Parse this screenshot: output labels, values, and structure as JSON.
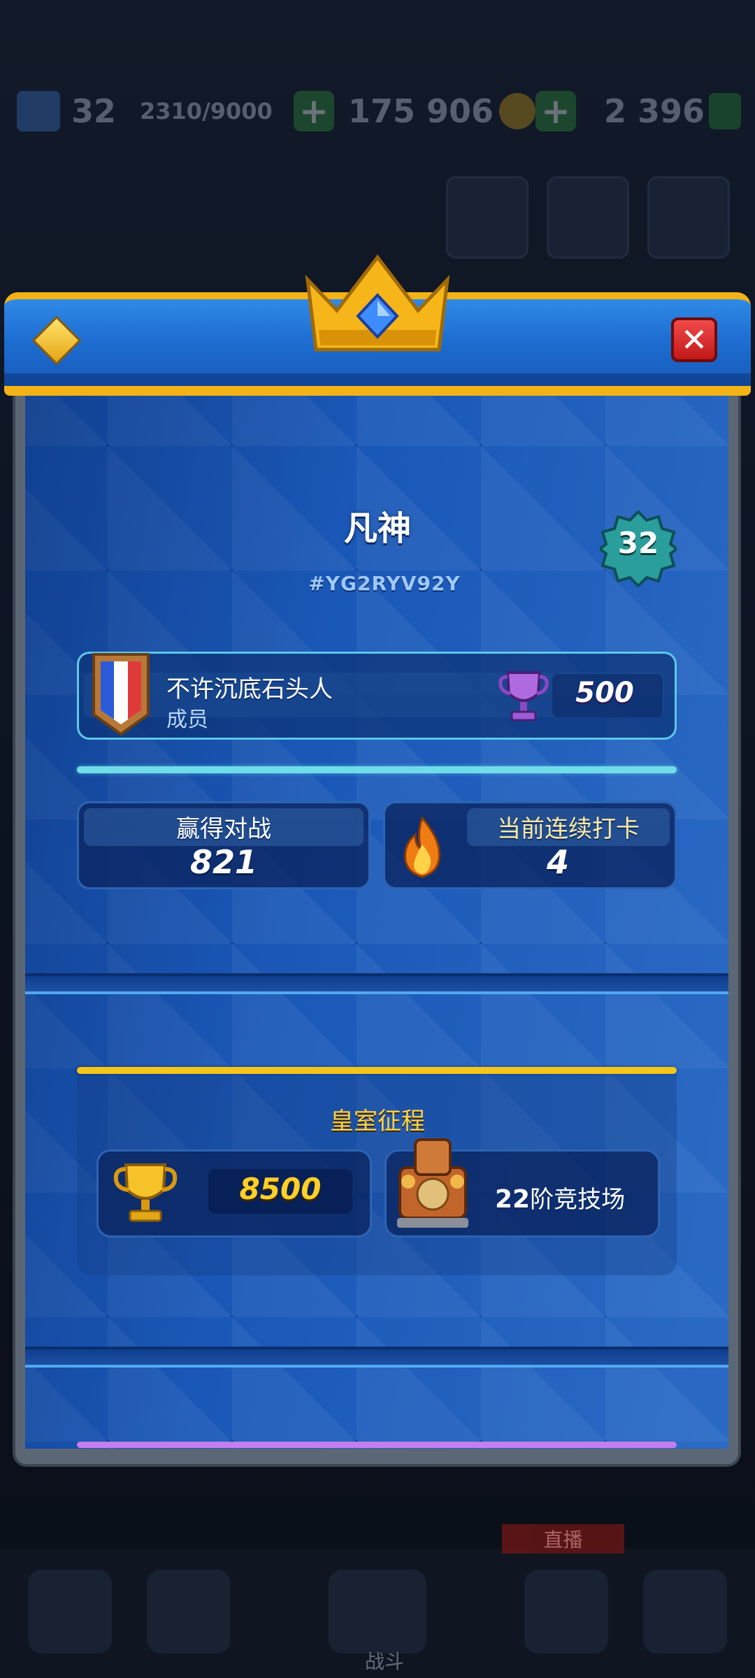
{
  "hud": {
    "level": "32",
    "xp": "2310/9000",
    "gold": "175 906",
    "gems": "2 396",
    "plus": "+"
  },
  "bottom_bar": {
    "live_label": "直播",
    "battle_label": "战斗"
  },
  "profile": {
    "close_symbol": "✕",
    "player_name": "凡神",
    "player_tag": "#YG2RYV92Y",
    "level": "32",
    "clan": {
      "name": "不许沉底石头人",
      "role": "成员",
      "trophies": "500"
    },
    "stats": {
      "wins_label": "赢得对战",
      "wins_value": "821",
      "streak_label": "当前连续打卡",
      "streak_value": "4"
    },
    "royal_path": {
      "title": "皇室征程",
      "trophies": "8500",
      "arena_number": "22",
      "arena_suffix": "阶竞技场"
    }
  },
  "colors": {
    "header_blue": "#1f6ed3",
    "gold_trim": "#f3b316",
    "panel_blue": "#1b58b7",
    "clan_border": "#5ec8e8",
    "path_gold": "#f4c51a",
    "close_red": "#d82222",
    "divider_purple": "#c57ef0"
  },
  "icons": [
    "crown-gem-icon",
    "gem-icon",
    "close-icon",
    "level-badge-icon",
    "clan-badge-icon",
    "purple-trophy-icon",
    "flame-icon",
    "gold-trophy-icon",
    "arena-icon"
  ]
}
